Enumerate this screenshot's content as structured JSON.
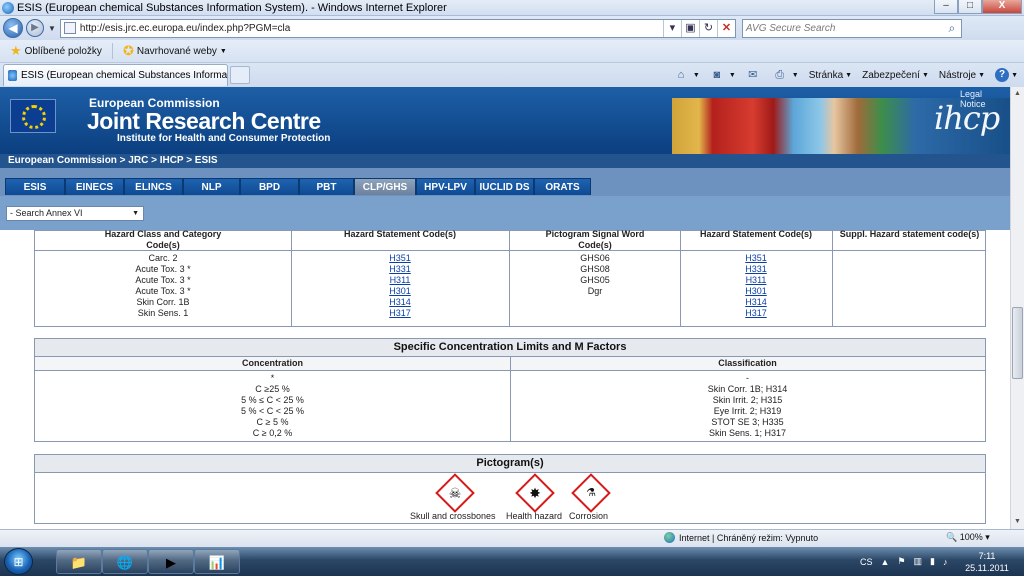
{
  "window": {
    "title": "ESIS (European chemical Substances Information System). - Windows Internet Explorer",
    "minimize": "–",
    "maximize": "□",
    "close": "X"
  },
  "navbar": {
    "back": "◀",
    "forward": "▶",
    "url": "http://esis.jrc.ec.europa.eu/index.php?PGM=cla",
    "search_placeholder": "AVG Secure Search"
  },
  "favorites": {
    "oblibene": "Oblíbené položky",
    "navrhovane": "Navrhované weby"
  },
  "browser_tab": {
    "label": "ESIS (European chemical Substances Information Syst..."
  },
  "command_bar": {
    "stranka": "Stránka",
    "zabezpeceni": "Zabezpečení",
    "nastroje": "Nástroje",
    "help": "?"
  },
  "header": {
    "legal_notice": "Legal Notice",
    "ec": "European Commission",
    "jrc": "Joint Research Centre",
    "institute": "Institute for Health and Consumer Protection",
    "logo": "ihcp"
  },
  "breadcrumb": "European Commission > JRC > IHCP > ESIS",
  "site_tabs": [
    "ESIS",
    "EINECS",
    "ELINCS",
    "NLP",
    "BPD",
    "PBT",
    "CLP/GHS",
    "HPV-LPV",
    "IUCLID DS",
    "ORATS"
  ],
  "active_tab": "CLP/GHS",
  "search_select": {
    "value": "- Search Annex VI",
    "arrow": "▼"
  },
  "classification_table": {
    "headers": [
      "Hazard Class and Category Code(s)",
      "Hazard Statement Code(s)",
      "Pictogram Signal Word Code(s)",
      "Hazard Statement Code(s)",
      "Suppl. Hazard statement code(s)"
    ],
    "hazard_classes": [
      "Carc. 2",
      "Acute Tox. 3 *",
      "Acute Tox. 3 *",
      "Acute Tox. 3 *",
      "Skin Corr. 1B",
      "Skin Sens. 1"
    ],
    "hazard_statements": [
      "H351",
      "H331",
      "H311",
      "H301",
      "H314",
      "H317"
    ],
    "pictogram_codes": [
      "GHS06",
      "GHS08",
      "GHS05",
      "Dgr"
    ],
    "labelling_statements": [
      "H351",
      "H331",
      "H311",
      "H301",
      "H314",
      "H317"
    ]
  },
  "scl_table": {
    "title": "Specific Concentration Limits and M Factors",
    "headers": [
      "Concentration",
      "Classification"
    ],
    "concentrations": [
      "*",
      "C ≥25 %",
      "5 % ≤ C < 25 %",
      "5 % < C < 25 %",
      "C ≥ 5 %",
      "C ≥ 0,2 %"
    ],
    "classifications": [
      "-",
      "Skin Corr. 1B; H314",
      "Skin Irrit. 2; H315",
      "Eye Irrit. 2; H319",
      "STOT SE 3; H335",
      "Skin Sens. 1; H317"
    ]
  },
  "pictograms": {
    "title": "Pictogram(s)",
    "items": [
      {
        "icon": "skull-and-crossbones-icon",
        "label": "Skull and crossbones"
      },
      {
        "icon": "health-hazard-icon",
        "label": "Health hazard"
      },
      {
        "icon": "corrosion-icon",
        "label": "Corrosion"
      }
    ]
  },
  "statusbar": {
    "zone": "Internet | Chráněný režim: Vypnuto",
    "zoom": "100%"
  },
  "tray": {
    "lang": "CS",
    "time": "7:11",
    "date": "25.11.2011"
  },
  "colors": {
    "header_blue": "#0b3f80",
    "tab_blue": "#1f63b0",
    "active_tab_gray": "#7a8fa9",
    "pictogram_red": "#d41a1a",
    "link_blue": "#0a3fa8"
  }
}
